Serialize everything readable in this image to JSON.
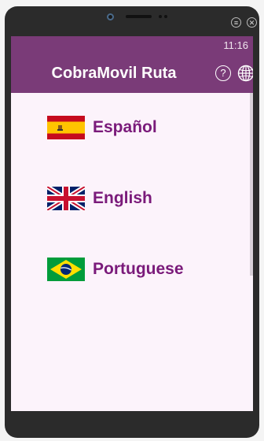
{
  "status_bar": {
    "time": "11:16"
  },
  "app_bar": {
    "title": "CobraMovil Ruta",
    "help_label": "?"
  },
  "emulator": {
    "menu_glyph": "≡",
    "close_glyph": "✕"
  },
  "languages": [
    {
      "label": "Español",
      "flag": "spain-flag-icon"
    },
    {
      "label": "English",
      "flag": "uk-flag-icon"
    },
    {
      "label": "Portuguese",
      "flag": "brazil-flag-icon"
    }
  ],
  "colors": {
    "app_bar": "#7a3b78",
    "language_text": "#7a1a7a",
    "screen_background": "#fcf3fb"
  }
}
